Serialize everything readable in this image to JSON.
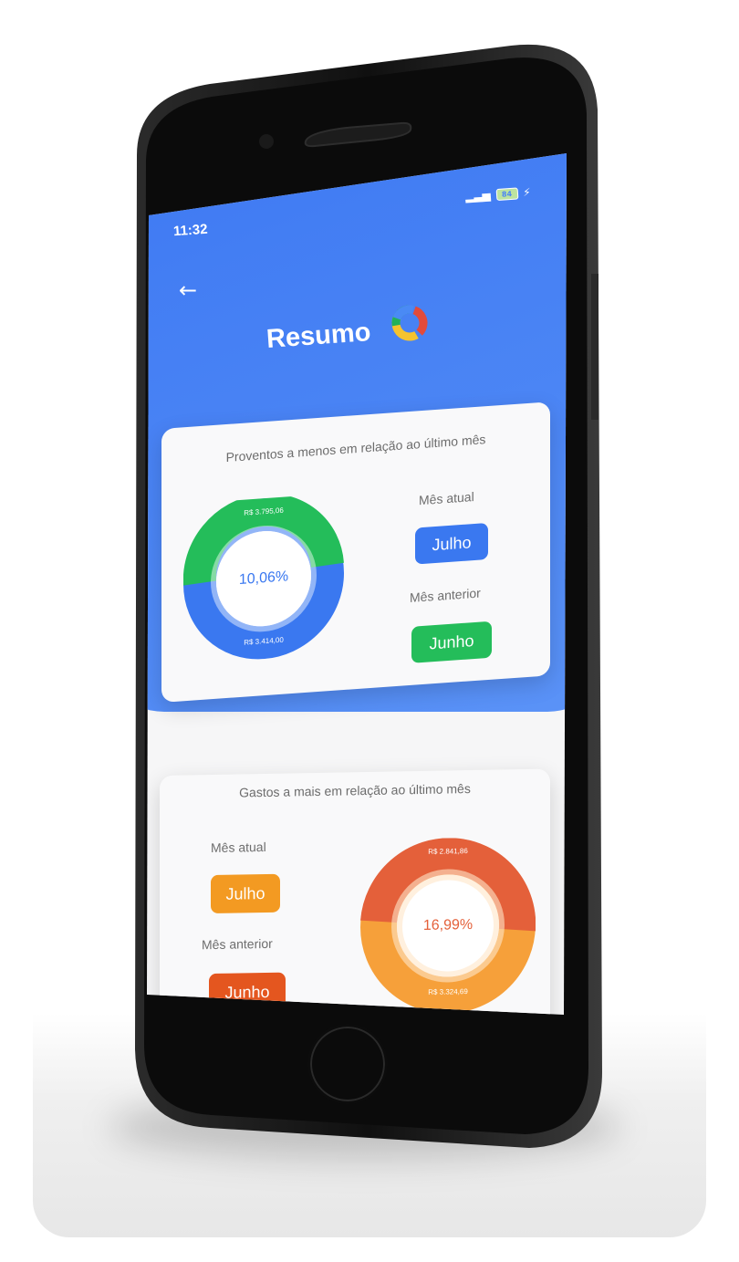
{
  "status_bar": {
    "time": "11:32",
    "battery": "84"
  },
  "header": {
    "title": "Resumo"
  },
  "earnings_card": {
    "title": "Proventos a menos em relação ao último mês",
    "current_label": "Mês atual",
    "current_month": "Julho",
    "previous_label": "Mês anterior",
    "previous_month": "Junho",
    "percent": "10,06%",
    "previous_amount": "R$ 3.795,06",
    "current_amount": "R$ 3.414,00",
    "colors": {
      "current": "#3a78f0",
      "previous": "#24bd5a",
      "percent_text": "#3a78f0"
    }
  },
  "expenses_card": {
    "title": "Gastos a mais em relação ao último mês",
    "current_label": "Mês atual",
    "current_month": "Julho",
    "previous_label": "Mês anterior",
    "previous_month": "Junho",
    "percent": "16,99%",
    "previous_amount": "R$ 2.841,86",
    "current_amount": "R$ 3.324,69",
    "colors": {
      "current": "#f6a03a",
      "previous": "#e4603a",
      "percent_text": "#e4603a"
    }
  },
  "icons": [
    "back-arrow-icon",
    "pie-chart-icon",
    "signal-icon",
    "battery-icon",
    "charging-icon"
  ]
}
